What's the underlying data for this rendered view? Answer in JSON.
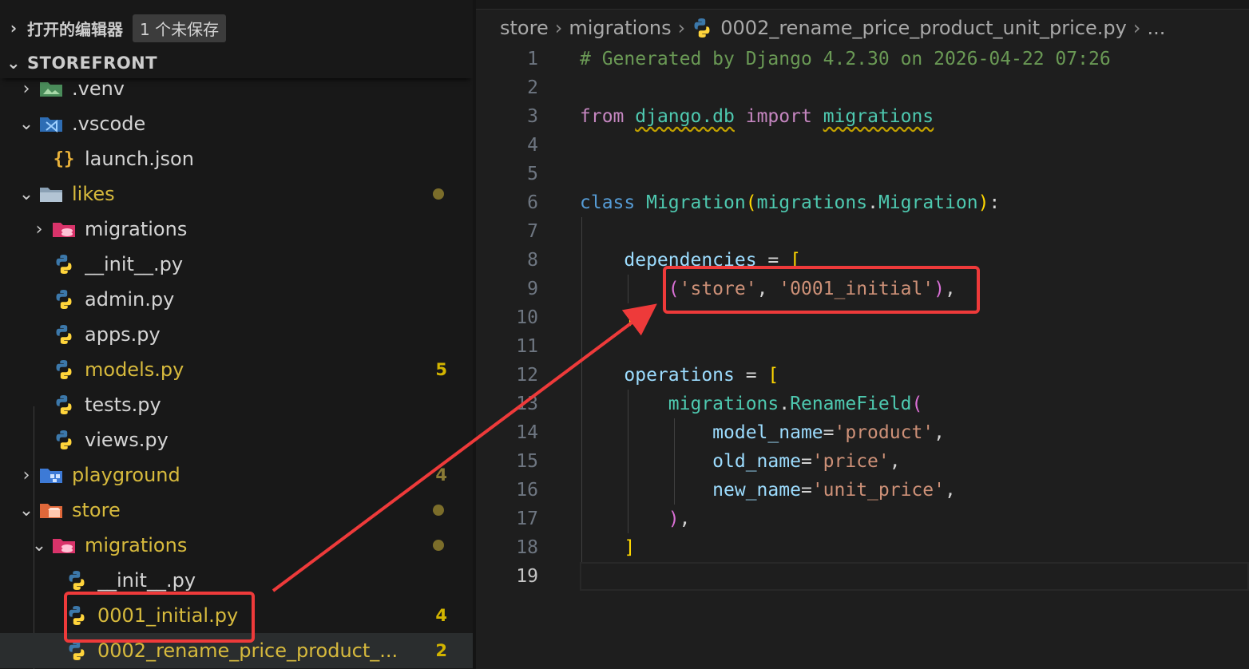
{
  "sidebar": {
    "open_editors_label": "打开的编辑器",
    "unsaved_badge": "1 个未保存",
    "explorer_root": "STOREFRONT",
    "items": [
      {
        "label": ".venv",
        "status": ""
      },
      {
        "label": ".vscode",
        "status": ""
      },
      {
        "label": "launch.json",
        "status": ""
      },
      {
        "label": "likes",
        "status": ""
      },
      {
        "label": "migrations",
        "status": ""
      },
      {
        "label": "__init__.py",
        "status": ""
      },
      {
        "label": "admin.py",
        "status": ""
      },
      {
        "label": "apps.py",
        "status": ""
      },
      {
        "label": "models.py",
        "status": "5"
      },
      {
        "label": "tests.py",
        "status": ""
      },
      {
        "label": "views.py",
        "status": ""
      },
      {
        "label": "playground",
        "status": "4"
      },
      {
        "label": "store",
        "status": ""
      },
      {
        "label": "migrations",
        "status": ""
      },
      {
        "label": "__init__.py",
        "status": ""
      },
      {
        "label": "0001_initial.py",
        "status": "4"
      },
      {
        "label": "0002_rename_price_product_...",
        "status": "2"
      }
    ]
  },
  "editor": {
    "breadcrumbs": [
      "store",
      "migrations",
      "0002_rename_price_product_unit_price.py",
      "..."
    ],
    "lines": [
      {
        "n": "1",
        "t": [
          "# Generated by Django 4.2.30 on 2026-04-22 07:26"
        ]
      },
      {
        "n": "2",
        "t": []
      },
      {
        "n": "3",
        "t": [
          "from",
          " ",
          "django.db",
          " ",
          "import",
          " ",
          "migrations"
        ]
      },
      {
        "n": "4",
        "t": []
      },
      {
        "n": "5",
        "t": []
      },
      {
        "n": "6",
        "t": [
          "class",
          " ",
          "Migration",
          "(",
          "migrations",
          ".",
          "Migration",
          ")",
          ":"
        ]
      },
      {
        "n": "7",
        "t": []
      },
      {
        "n": "8",
        "t": [
          "    ",
          "dependencies",
          " = ",
          "["
        ]
      },
      {
        "n": "9",
        "t": [
          "        ",
          "(",
          "'store'",
          ", ",
          "'0001_initial'",
          ")",
          ","
        ]
      },
      {
        "n": "10",
        "t": [
          "    ",
          "]"
        ]
      },
      {
        "n": "11",
        "t": []
      },
      {
        "n": "12",
        "t": [
          "    ",
          "operations",
          " = ",
          "["
        ]
      },
      {
        "n": "13",
        "t": [
          "        ",
          "migrations",
          ".",
          "RenameField",
          "("
        ]
      },
      {
        "n": "14",
        "t": [
          "            ",
          "model_name",
          "=",
          "'product'",
          ","
        ]
      },
      {
        "n": "15",
        "t": [
          "            ",
          "old_name",
          "=",
          "'price'",
          ","
        ]
      },
      {
        "n": "16",
        "t": [
          "            ",
          "new_name",
          "=",
          "'unit_price'",
          ","
        ]
      },
      {
        "n": "17",
        "t": [
          "        ",
          ")",
          ","
        ]
      },
      {
        "n": "18",
        "t": [
          "    ",
          "]"
        ]
      },
      {
        "n": "19",
        "t": []
      }
    ]
  },
  "colors": {
    "annotation_red": "#ee3a3a",
    "modified_yellow": "#d7ba3d",
    "accent_python_blue": "#3c78aa",
    "accent_python_yellow": "#ffd43b"
  },
  "icons": [
    "folder-venv-icon",
    "folder-vscode-icon",
    "json-braces-icon",
    "folder-icon",
    "folder-migrations-icon",
    "python-icon",
    "folder-playground-icon",
    "folder-store-icon"
  ]
}
